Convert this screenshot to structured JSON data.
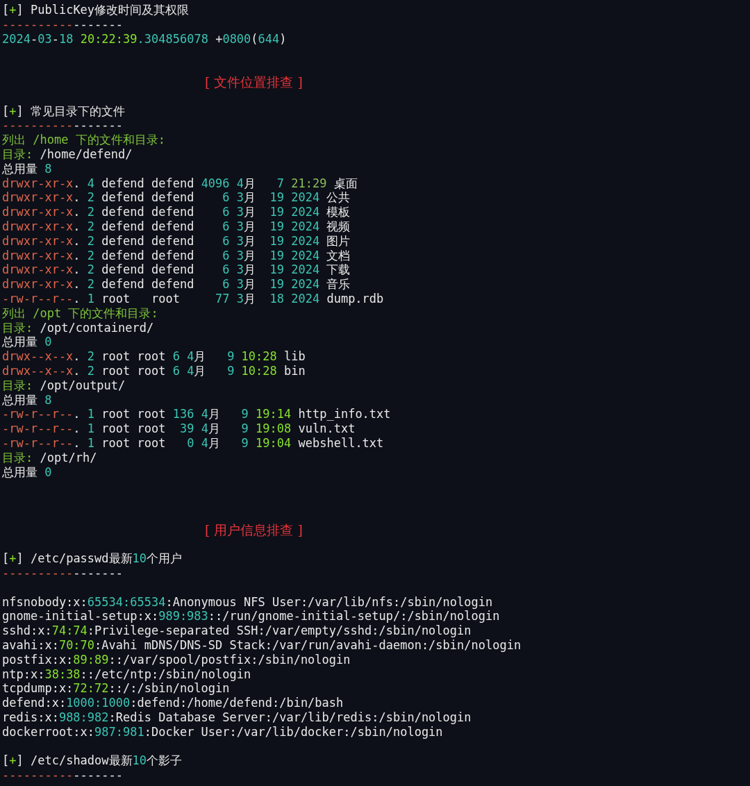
{
  "lines": [
    {
      "kind": "text",
      "spans": [
        {
          "text": "[",
          "kind": "plain"
        },
        {
          "text": "+",
          "kind": "time"
        },
        {
          "text": "] PublicKey修改时间及其权限",
          "kind": "plain"
        }
      ]
    },
    {
      "kind": "text",
      "spans": [
        {
          "text": "----------",
          "kind": "red"
        },
        {
          "text": "-------",
          "kind": "plain"
        }
      ]
    },
    {
      "kind": "text",
      "spans": [
        {
          "text": "2024",
          "kind": "num"
        },
        {
          "text": "-",
          "kind": "plain"
        },
        {
          "text": "03",
          "kind": "num"
        },
        {
          "text": "-",
          "kind": "plain"
        },
        {
          "text": "18",
          "kind": "num"
        },
        {
          "text": " 20:22:39",
          "kind": "time"
        },
        {
          "text": ".304856078",
          "kind": "num"
        },
        {
          "text": " +",
          "kind": "plain"
        },
        {
          "text": "0800",
          "kind": "num"
        },
        {
          "text": "(",
          "kind": "plain"
        },
        {
          "text": "644",
          "kind": "num"
        },
        {
          "text": ")",
          "kind": "plain"
        }
      ]
    },
    {
      "kind": "blank"
    },
    {
      "kind": "blank"
    },
    {
      "kind": "heading",
      "spans": [
        {
          "text": "[ 文件位置排查 ]",
          "kind": "heading"
        }
      ]
    },
    {
      "kind": "blank"
    },
    {
      "kind": "text",
      "spans": [
        {
          "text": "[",
          "kind": "plain"
        },
        {
          "text": "+",
          "kind": "time"
        },
        {
          "text": "] 常见目录下的文件",
          "kind": "plain"
        }
      ]
    },
    {
      "kind": "text",
      "spans": [
        {
          "text": "----------",
          "kind": "red"
        },
        {
          "text": "-------",
          "kind": "plain"
        }
      ]
    },
    {
      "kind": "text",
      "spans": [
        {
          "text": "列出 /home 下的文件和目录:",
          "kind": "label"
        }
      ]
    },
    {
      "kind": "text",
      "spans": [
        {
          "text": "目录:",
          "kind": "label"
        },
        {
          "text": " /home/defend/",
          "kind": "plain"
        }
      ]
    },
    {
      "kind": "text",
      "spans": [
        {
          "text": "总用量 ",
          "kind": "plain"
        },
        {
          "text": "8",
          "kind": "num"
        }
      ]
    },
    {
      "kind": "text",
      "spans": [
        {
          "text": "drwxr-xr-x",
          "kind": "perm"
        },
        {
          "text": ". ",
          "kind": "plain"
        },
        {
          "text": "4",
          "kind": "num"
        },
        {
          "text": " defend defend ",
          "kind": "plain"
        },
        {
          "text": "4096 4",
          "kind": "num"
        },
        {
          "text": "月   ",
          "kind": "plain"
        },
        {
          "text": "7",
          "kind": "num"
        },
        {
          "text": " 21:29",
          "kind": "dimtime"
        },
        {
          "text": " 桌面",
          "kind": "plain"
        }
      ]
    },
    {
      "kind": "text",
      "spans": [
        {
          "text": "drwxr-xr-x",
          "kind": "perm"
        },
        {
          "text": ". ",
          "kind": "plain"
        },
        {
          "text": "2",
          "kind": "num"
        },
        {
          "text": " defend defend    ",
          "kind": "plain"
        },
        {
          "text": "6 3",
          "kind": "num"
        },
        {
          "text": "月  ",
          "kind": "plain"
        },
        {
          "text": "19 2024",
          "kind": "num"
        },
        {
          "text": " 公共",
          "kind": "plain"
        }
      ]
    },
    {
      "kind": "text",
      "spans": [
        {
          "text": "drwxr-xr-x",
          "kind": "perm"
        },
        {
          "text": ". ",
          "kind": "plain"
        },
        {
          "text": "2",
          "kind": "num"
        },
        {
          "text": " defend defend    ",
          "kind": "plain"
        },
        {
          "text": "6 3",
          "kind": "num"
        },
        {
          "text": "月  ",
          "kind": "plain"
        },
        {
          "text": "19 2024",
          "kind": "num"
        },
        {
          "text": " 模板",
          "kind": "plain"
        }
      ]
    },
    {
      "kind": "text",
      "spans": [
        {
          "text": "drwxr-xr-x",
          "kind": "perm"
        },
        {
          "text": ". ",
          "kind": "plain"
        },
        {
          "text": "2",
          "kind": "num"
        },
        {
          "text": " defend defend    ",
          "kind": "plain"
        },
        {
          "text": "6 3",
          "kind": "num"
        },
        {
          "text": "月  ",
          "kind": "plain"
        },
        {
          "text": "19 2024",
          "kind": "num"
        },
        {
          "text": " 视频",
          "kind": "plain"
        }
      ]
    },
    {
      "kind": "text",
      "spans": [
        {
          "text": "drwxr-xr-x",
          "kind": "perm"
        },
        {
          "text": ". ",
          "kind": "plain"
        },
        {
          "text": "2",
          "kind": "num"
        },
        {
          "text": " defend defend    ",
          "kind": "plain"
        },
        {
          "text": "6 3",
          "kind": "num"
        },
        {
          "text": "月  ",
          "kind": "plain"
        },
        {
          "text": "19 2024",
          "kind": "num"
        },
        {
          "text": " 图片",
          "kind": "plain"
        }
      ]
    },
    {
      "kind": "text",
      "spans": [
        {
          "text": "drwxr-xr-x",
          "kind": "perm"
        },
        {
          "text": ". ",
          "kind": "plain"
        },
        {
          "text": "2",
          "kind": "num"
        },
        {
          "text": " defend defend    ",
          "kind": "plain"
        },
        {
          "text": "6 3",
          "kind": "num"
        },
        {
          "text": "月  ",
          "kind": "plain"
        },
        {
          "text": "19 2024",
          "kind": "num"
        },
        {
          "text": " 文档",
          "kind": "plain"
        }
      ]
    },
    {
      "kind": "text",
      "spans": [
        {
          "text": "drwxr-xr-x",
          "kind": "perm"
        },
        {
          "text": ". ",
          "kind": "plain"
        },
        {
          "text": "2",
          "kind": "num"
        },
        {
          "text": " defend defend    ",
          "kind": "plain"
        },
        {
          "text": "6 3",
          "kind": "num"
        },
        {
          "text": "月  ",
          "kind": "plain"
        },
        {
          "text": "19 2024",
          "kind": "num"
        },
        {
          "text": " 下载",
          "kind": "plain"
        }
      ]
    },
    {
      "kind": "text",
      "spans": [
        {
          "text": "drwxr-xr-x",
          "kind": "perm"
        },
        {
          "text": ". ",
          "kind": "plain"
        },
        {
          "text": "2",
          "kind": "num"
        },
        {
          "text": " defend defend    ",
          "kind": "plain"
        },
        {
          "text": "6 3",
          "kind": "num"
        },
        {
          "text": "月  ",
          "kind": "plain"
        },
        {
          "text": "19 2024",
          "kind": "num"
        },
        {
          "text": " 音乐",
          "kind": "plain"
        }
      ]
    },
    {
      "kind": "text",
      "spans": [
        {
          "text": "-rw-r--r--",
          "kind": "perm"
        },
        {
          "text": ". ",
          "kind": "plain"
        },
        {
          "text": "1",
          "kind": "num"
        },
        {
          "text": " root   root     ",
          "kind": "plain"
        },
        {
          "text": "77 3",
          "kind": "num"
        },
        {
          "text": "月  ",
          "kind": "plain"
        },
        {
          "text": "18 2024",
          "kind": "num"
        },
        {
          "text": " dump.rdb",
          "kind": "plain"
        }
      ]
    },
    {
      "kind": "text",
      "spans": [
        {
          "text": "列出 /opt 下的文件和目录:",
          "kind": "label"
        }
      ]
    },
    {
      "kind": "text",
      "spans": [
        {
          "text": "目录:",
          "kind": "label"
        },
        {
          "text": " /opt/containerd/",
          "kind": "plain"
        }
      ]
    },
    {
      "kind": "text",
      "spans": [
        {
          "text": "总用量 ",
          "kind": "plain"
        },
        {
          "text": "0",
          "kind": "num"
        }
      ]
    },
    {
      "kind": "text",
      "spans": [
        {
          "text": "drwx--x--x",
          "kind": "perm"
        },
        {
          "text": ". ",
          "kind": "plain"
        },
        {
          "text": "2",
          "kind": "num"
        },
        {
          "text": " root root ",
          "kind": "plain"
        },
        {
          "text": "6 4",
          "kind": "num"
        },
        {
          "text": "月   ",
          "kind": "plain"
        },
        {
          "text": "9",
          "kind": "num"
        },
        {
          "text": " 10:28",
          "kind": "time"
        },
        {
          "text": " lib",
          "kind": "plain"
        }
      ]
    },
    {
      "kind": "text",
      "spans": [
        {
          "text": "drwx--x--x",
          "kind": "perm"
        },
        {
          "text": ". ",
          "kind": "plain"
        },
        {
          "text": "2",
          "kind": "num"
        },
        {
          "text": " root root ",
          "kind": "plain"
        },
        {
          "text": "6 4",
          "kind": "num"
        },
        {
          "text": "月   ",
          "kind": "plain"
        },
        {
          "text": "9",
          "kind": "num"
        },
        {
          "text": " 10:28",
          "kind": "time"
        },
        {
          "text": " bin",
          "kind": "plain"
        }
      ]
    },
    {
      "kind": "text",
      "spans": [
        {
          "text": "目录:",
          "kind": "label"
        },
        {
          "text": " /opt/output/",
          "kind": "plain"
        }
      ]
    },
    {
      "kind": "text",
      "spans": [
        {
          "text": "总用量 ",
          "kind": "plain"
        },
        {
          "text": "8",
          "kind": "num"
        }
      ]
    },
    {
      "kind": "text",
      "spans": [
        {
          "text": "-rw-r--r--",
          "kind": "perm"
        },
        {
          "text": ". ",
          "kind": "plain"
        },
        {
          "text": "1",
          "kind": "num"
        },
        {
          "text": " root root ",
          "kind": "plain"
        },
        {
          "text": "136 4",
          "kind": "num"
        },
        {
          "text": "月   ",
          "kind": "plain"
        },
        {
          "text": "9",
          "kind": "num"
        },
        {
          "text": " 19:14",
          "kind": "time"
        },
        {
          "text": " http_info.txt",
          "kind": "plain"
        }
      ]
    },
    {
      "kind": "text",
      "spans": [
        {
          "text": "-rw-r--r--",
          "kind": "perm"
        },
        {
          "text": ". ",
          "kind": "plain"
        },
        {
          "text": "1",
          "kind": "num"
        },
        {
          "text": " root root  ",
          "kind": "plain"
        },
        {
          "text": "39 4",
          "kind": "num"
        },
        {
          "text": "月   ",
          "kind": "plain"
        },
        {
          "text": "9",
          "kind": "num"
        },
        {
          "text": " 19:08",
          "kind": "time"
        },
        {
          "text": " vuln.txt",
          "kind": "plain"
        }
      ]
    },
    {
      "kind": "text",
      "spans": [
        {
          "text": "-rw-r--r--",
          "kind": "perm"
        },
        {
          "text": ". ",
          "kind": "plain"
        },
        {
          "text": "1",
          "kind": "num"
        },
        {
          "text": " root root   ",
          "kind": "plain"
        },
        {
          "text": "0 4",
          "kind": "num"
        },
        {
          "text": "月   ",
          "kind": "plain"
        },
        {
          "text": "9",
          "kind": "num"
        },
        {
          "text": " 19:04",
          "kind": "time"
        },
        {
          "text": " webshell.txt",
          "kind": "plain"
        }
      ]
    },
    {
      "kind": "text",
      "spans": [
        {
          "text": "目录:",
          "kind": "label"
        },
        {
          "text": " /opt/rh/",
          "kind": "plain"
        }
      ]
    },
    {
      "kind": "text",
      "spans": [
        {
          "text": "总用量 ",
          "kind": "plain"
        },
        {
          "text": "0",
          "kind": "num"
        }
      ]
    },
    {
      "kind": "blank"
    },
    {
      "kind": "blank"
    },
    {
      "kind": "blank"
    },
    {
      "kind": "heading",
      "spans": [
        {
          "text": "[ 用户信息排查 ]",
          "kind": "heading"
        }
      ]
    },
    {
      "kind": "blank"
    },
    {
      "kind": "text",
      "spans": [
        {
          "text": "[",
          "kind": "plain"
        },
        {
          "text": "+",
          "kind": "time"
        },
        {
          "text": "] /etc/passwd最新",
          "kind": "plain"
        },
        {
          "text": "10",
          "kind": "num"
        },
        {
          "text": "个用户",
          "kind": "plain"
        }
      ]
    },
    {
      "kind": "text",
      "spans": [
        {
          "text": "----------",
          "kind": "red"
        },
        {
          "text": "-------",
          "kind": "plain"
        }
      ]
    },
    {
      "kind": "blank"
    },
    {
      "kind": "text",
      "spans": [
        {
          "text": "nfsnobody:x:",
          "kind": "plain"
        },
        {
          "text": "65534:65534",
          "kind": "num"
        },
        {
          "text": ":Anonymous NFS User:/var/lib/nfs:/sbin/nologin",
          "kind": "plain"
        }
      ]
    },
    {
      "kind": "text",
      "spans": [
        {
          "text": "gnome-initial-setup:x:",
          "kind": "plain"
        },
        {
          "text": "989:983",
          "kind": "num"
        },
        {
          "text": "::/run/gnome-initial-setup/:/sbin/nologin",
          "kind": "plain"
        }
      ]
    },
    {
      "kind": "text",
      "spans": [
        {
          "text": "sshd:x:",
          "kind": "plain"
        },
        {
          "text": "74:74",
          "kind": "time"
        },
        {
          "text": ":Privilege-separated SSH:/var/empty/sshd:/sbin/nologin",
          "kind": "plain"
        }
      ]
    },
    {
      "kind": "text",
      "spans": [
        {
          "text": "avahi:x:",
          "kind": "plain"
        },
        {
          "text": "70:70",
          "kind": "time"
        },
        {
          "text": ":Avahi mDNS/DNS-SD Stack:/var/run/avahi-daemon:/sbin/nologin",
          "kind": "plain"
        }
      ]
    },
    {
      "kind": "text",
      "spans": [
        {
          "text": "postfix:x:",
          "kind": "plain"
        },
        {
          "text": "89:89",
          "kind": "time"
        },
        {
          "text": "::/var/spool/postfix:/sbin/nologin",
          "kind": "plain"
        }
      ]
    },
    {
      "kind": "text",
      "spans": [
        {
          "text": "ntp:x:",
          "kind": "plain"
        },
        {
          "text": "38:38",
          "kind": "time"
        },
        {
          "text": "::/etc/ntp:/sbin/nologin",
          "kind": "plain"
        }
      ]
    },
    {
      "kind": "text",
      "spans": [
        {
          "text": "tcpdump:x:",
          "kind": "plain"
        },
        {
          "text": "72:72",
          "kind": "time"
        },
        {
          "text": "::/:/sbin/nologin",
          "kind": "plain"
        }
      ]
    },
    {
      "kind": "text",
      "spans": [
        {
          "text": "defend:x:",
          "kind": "plain"
        },
        {
          "text": "1000:1000",
          "kind": "num"
        },
        {
          "text": ":defend:/home/defend:/bin/bash",
          "kind": "plain"
        }
      ]
    },
    {
      "kind": "text",
      "spans": [
        {
          "text": "redis:x:",
          "kind": "plain"
        },
        {
          "text": "988:982",
          "kind": "num"
        },
        {
          "text": ":Redis Database Server:/var/lib/redis:/sbin/nologin",
          "kind": "plain"
        }
      ]
    },
    {
      "kind": "text",
      "spans": [
        {
          "text": "dockerroot:x:",
          "kind": "plain"
        },
        {
          "text": "987:981",
          "kind": "num"
        },
        {
          "text": ":Docker User:/var/lib/docker:/sbin/nologin",
          "kind": "plain"
        }
      ]
    },
    {
      "kind": "blank"
    },
    {
      "kind": "text",
      "spans": [
        {
          "text": "[",
          "kind": "plain"
        },
        {
          "text": "+",
          "kind": "time"
        },
        {
          "text": "] /etc/shadow最新",
          "kind": "plain"
        },
        {
          "text": "10",
          "kind": "num"
        },
        {
          "text": "个影子",
          "kind": "plain"
        }
      ]
    },
    {
      "kind": "text",
      "spans": [
        {
          "text": "----------",
          "kind": "red"
        },
        {
          "text": "-------",
          "kind": "plain"
        }
      ]
    }
  ]
}
